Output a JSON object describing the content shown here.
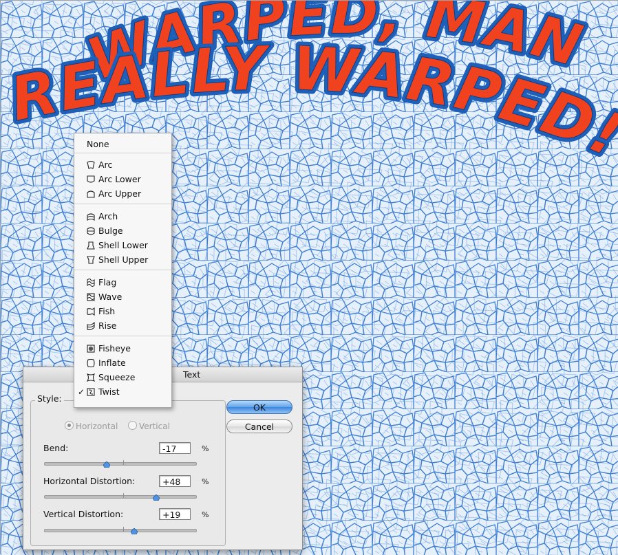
{
  "canvas": {
    "headline_line1": "WARPED, MAN,",
    "headline_line2": "REALLY WARPED!",
    "text_fill_color": "#f0421f",
    "text_stroke_color": "#1e5fb8",
    "pattern_color": "#3f7fd2"
  },
  "warp_menu": {
    "items": [
      {
        "label": "None",
        "icon": "none",
        "checked": false
      },
      {
        "label": "Arc",
        "icon": "arc-icon",
        "checked": false
      },
      {
        "label": "Arc Lower",
        "icon": "arc-lower-icon",
        "checked": false
      },
      {
        "label": "Arc Upper",
        "icon": "arc-upper-icon",
        "checked": false
      },
      {
        "label": "Arch",
        "icon": "arch-icon",
        "checked": false
      },
      {
        "label": "Bulge",
        "icon": "bulge-icon",
        "checked": false
      },
      {
        "label": "Shell Lower",
        "icon": "shell-lower-icon",
        "checked": false
      },
      {
        "label": "Shell Upper",
        "icon": "shell-upper-icon",
        "checked": false
      },
      {
        "label": "Flag",
        "icon": "flag-icon",
        "checked": false
      },
      {
        "label": "Wave",
        "icon": "wave-icon",
        "checked": false
      },
      {
        "label": "Fish",
        "icon": "fish-icon",
        "checked": false
      },
      {
        "label": "Rise",
        "icon": "rise-icon",
        "checked": false
      },
      {
        "label": "Fisheye",
        "icon": "fisheye-icon",
        "checked": false
      },
      {
        "label": "Inflate",
        "icon": "inflate-icon",
        "checked": false
      },
      {
        "label": "Squeeze",
        "icon": "squeeze-icon",
        "checked": false
      },
      {
        "label": "Twist",
        "icon": "twist-icon",
        "checked": true
      }
    ],
    "check_mark": "✓"
  },
  "dialog": {
    "title_fragment": "Text",
    "style_label": "Style:",
    "orientation": {
      "horizontal_label": "Horizontal",
      "vertical_label": "Vertical",
      "selected": "Horizontal"
    },
    "bend": {
      "label": "Bend:",
      "value": "-17",
      "unit": "%",
      "amount": -17
    },
    "horizontal_distortion": {
      "label": "Horizontal Distortion:",
      "value": "+48",
      "unit": "%",
      "amount": 48
    },
    "vertical_distortion": {
      "label": "Vertical Distortion:",
      "value": "+19",
      "unit": "%",
      "amount": 19
    },
    "ok_label": "OK",
    "cancel_label": "Cancel"
  }
}
